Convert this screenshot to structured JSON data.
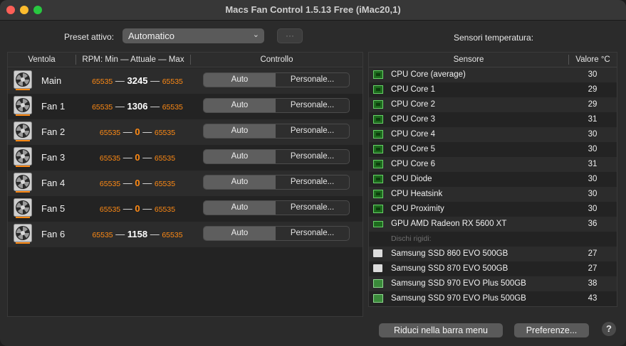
{
  "window": {
    "title": "Macs Fan Control 1.5.13 Free (iMac20,1)"
  },
  "preset": {
    "label": "Preset attivo:",
    "value": "Automatico",
    "more_glyph": "···"
  },
  "sensors_label": "Sensori temperatura:",
  "fan_table": {
    "headers": {
      "fan": "Ventola",
      "rpm": "RPM: Min — Attuale — Max",
      "control": "Controllo"
    },
    "auto_label": "Auto",
    "custom_label": "Personale...",
    "dash": "—",
    "rows": [
      {
        "name": "Main",
        "min": "65535",
        "current": "3245",
        "max": "65535"
      },
      {
        "name": "Fan 1",
        "min": "65535",
        "current": "1306",
        "max": "65535"
      },
      {
        "name": "Fan 2",
        "min": "65535",
        "current": "0",
        "max": "65535"
      },
      {
        "name": "Fan 3",
        "min": "65535",
        "current": "0",
        "max": "65535"
      },
      {
        "name": "Fan 4",
        "min": "65535",
        "current": "0",
        "max": "65535"
      },
      {
        "name": "Fan 5",
        "min": "65535",
        "current": "0",
        "max": "65535"
      },
      {
        "name": "Fan 6",
        "min": "65535",
        "current": "1158",
        "max": "65535"
      }
    ]
  },
  "sensor_table": {
    "headers": {
      "sensor": "Sensore",
      "value": "Valore °C"
    },
    "rows": [
      {
        "name": "CPU Core (average)",
        "value": "30",
        "icon": "cpu-chip-icon"
      },
      {
        "name": "CPU Core 1",
        "value": "29",
        "icon": "cpu-chip-icon"
      },
      {
        "name": "CPU Core 2",
        "value": "29",
        "icon": "cpu-chip-icon"
      },
      {
        "name": "CPU Core 3",
        "value": "31",
        "icon": "cpu-chip-icon"
      },
      {
        "name": "CPU Core 4",
        "value": "30",
        "icon": "cpu-chip-icon"
      },
      {
        "name": "CPU Core 5",
        "value": "30",
        "icon": "cpu-chip-icon"
      },
      {
        "name": "CPU Core 6",
        "value": "31",
        "icon": "cpu-chip-icon"
      },
      {
        "name": "CPU Diode",
        "value": "30",
        "icon": "cpu-chip-icon"
      },
      {
        "name": "CPU Heatsink",
        "value": "30",
        "icon": "cpu-chip-icon"
      },
      {
        "name": "CPU Proximity",
        "value": "30",
        "icon": "cpu-chip-icon"
      },
      {
        "name": "GPU AMD Radeon RX 5600 XT",
        "value": "36",
        "icon": "gpu-card-icon"
      }
    ],
    "group_label": "Dischi rigidi:",
    "disk_rows": [
      {
        "name": "Samsung SSD 860 EVO 500GB",
        "value": "27",
        "icon": "hard-disk-icon"
      },
      {
        "name": "Samsung SSD 870 EVO 500GB",
        "value": "27",
        "icon": "hard-disk-icon"
      },
      {
        "name": "Samsung SSD 970 EVO Plus 500GB",
        "value": "38",
        "icon": "nvme-drive-icon"
      },
      {
        "name": "Samsung SSD 970 EVO Plus 500GB",
        "value": "43",
        "icon": "nvme-drive-icon"
      }
    ]
  },
  "buttons": {
    "minimize": "Riduci nella barra menu",
    "preferences": "Preferenze...",
    "help": "?"
  },
  "colors": {
    "rpm_accent": "#ff8a14",
    "chip_green": "#67d167"
  }
}
